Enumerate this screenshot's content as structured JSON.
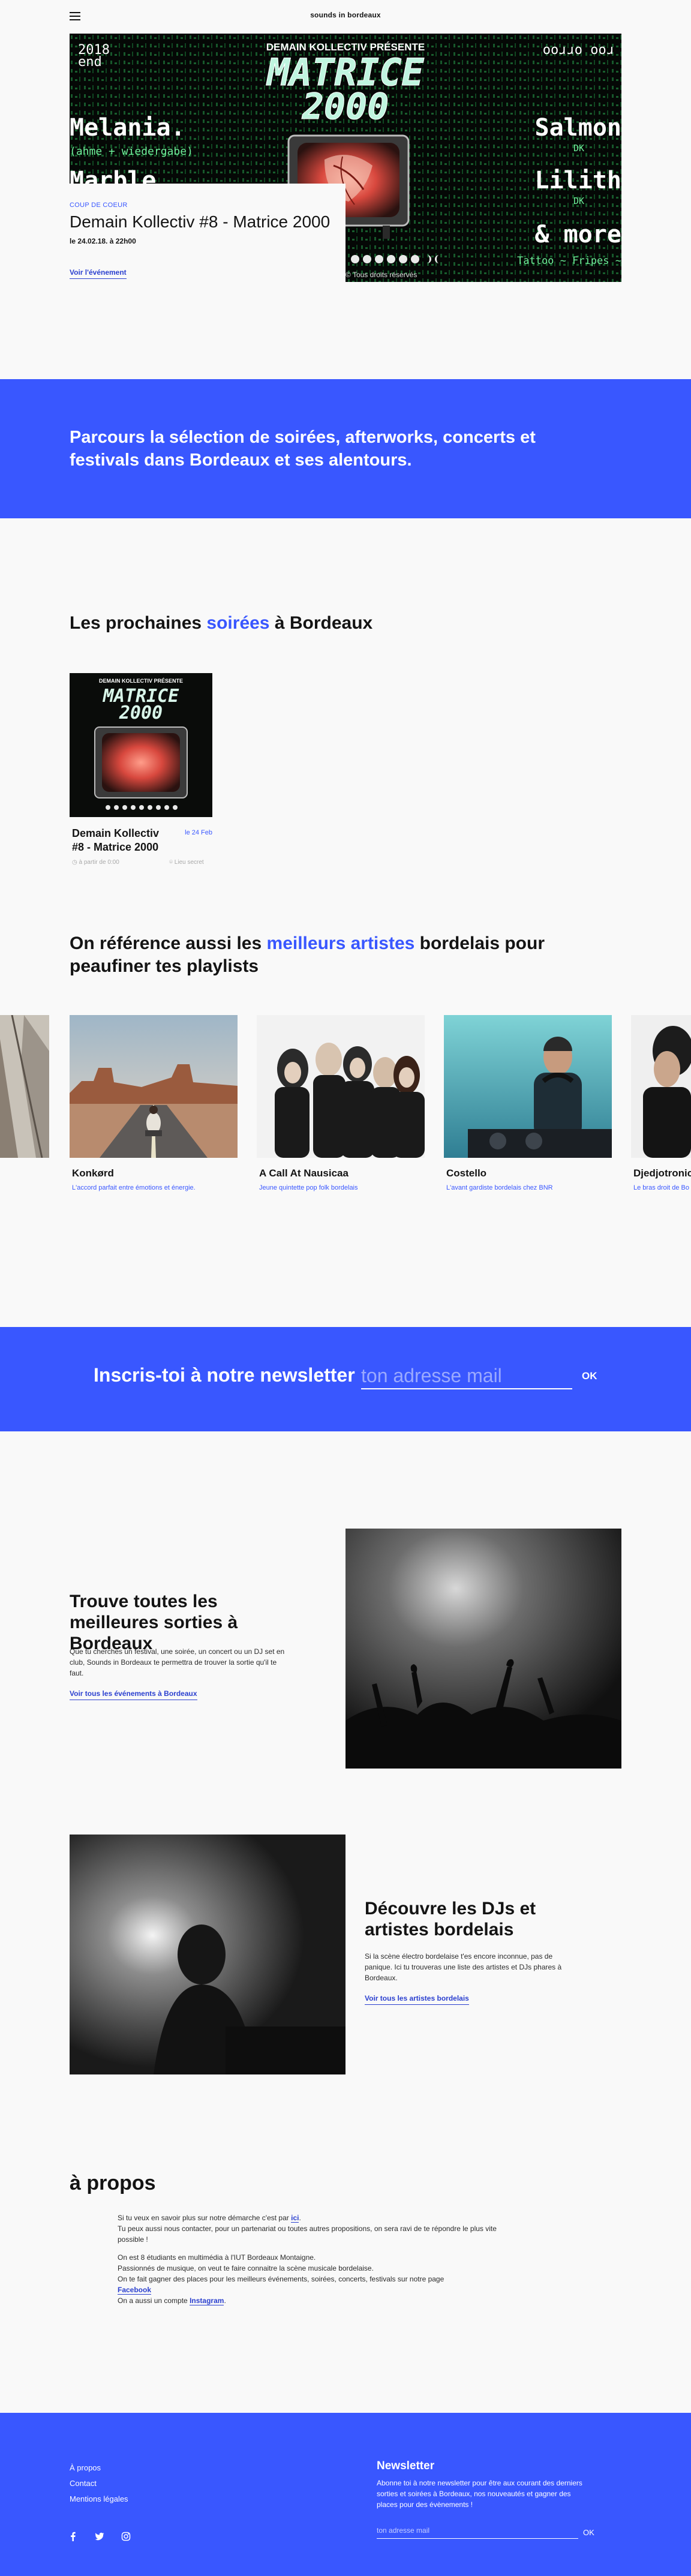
{
  "header": {
    "site_title": "sounds in bordeaux"
  },
  "hero": {
    "kicker": "COUP DE COEUR",
    "title": "Demain Kollectiv #8 - Matrice 2000",
    "date": "le 24.02.18. à 22h00",
    "link": "Voir l'événement",
    "poster": {
      "top_banner": "DEMAIN KOLLECTIV PRÉSENTE",
      "logo": "MATRICE",
      "logo_year": "2000",
      "corner_left": "2018",
      "corner_left_2": "end",
      "corner_right": "ooɹɹo ooɹ",
      "artists_left": [
        "Melania.",
        "Marble"
      ],
      "artists_left_sub": "(ahme + wiedergabe)",
      "artists_right": [
        "Salmon",
        "Lilith",
        "& more"
      ],
      "artists_right_sub": [
        "DK",
        "DK"
      ],
      "tagline": "Tattoo ~ Fripes ~ ",
      "credit": "© Tous droits réservés"
    }
  },
  "intro_band": {
    "text": "Parcours la sélection de soirées, afterworks, concerts et festivals dans Bordeaux et ses alentours."
  },
  "events_section": {
    "title_before": "Les prochaines ",
    "title_highlight": "soirées",
    "title_after": " à Bordeaux",
    "events": [
      {
        "title": "Demain Kollectiv #8 - Matrice 2000",
        "date": "le 24 Feb",
        "time": "à partir de 0:00",
        "place": "Lieu secret"
      }
    ]
  },
  "artists_section": {
    "title_before": "On référence aussi les ",
    "title_highlight": "meilleurs artistes",
    "title_after": " bordelais pour peaufiner tes playlists",
    "artists": [
      {
        "name": "Konkørd",
        "desc": "L'accord parfait entre émotions et énergie."
      },
      {
        "name": "A Call At Nausicaa",
        "desc": "Jeune quintette pop folk bordelais"
      },
      {
        "name": "Costello",
        "desc": "L'avant gardiste bordelais chez BNR"
      },
      {
        "name": "Djedjotronic",
        "desc": "Le bras droit de Bo"
      }
    ]
  },
  "newsletter_band": {
    "label": "Inscris-toi à notre newsletter",
    "placeholder": "ton adresse mail",
    "ok": "OK"
  },
  "feature_events": {
    "title": "Trouve toutes les meilleures sorties à Bordeaux",
    "text": "Que tu cherches un festival, une soirée, un concert ou un DJ set en club, Sounds in Bordeaux te permettra de trouver la sortie qu'il te faut.",
    "link": "Voir tous les événements à Bordeaux"
  },
  "feature_artists": {
    "title": "Découvre les DJs et artistes bordelais",
    "text": "Si la scène électro bordelaise t'es encore inconnue, pas de panique. Ici tu trouveras une liste des artistes et DJs phares à Bordeaux.",
    "link": "Voir tous les artistes bordelais"
  },
  "about": {
    "title": "à propos",
    "p1_before": "Si tu veux en savoir plus sur notre démarche c'est par ",
    "p1_link": "ici",
    "p1_after": ".",
    "p2": "Tu peux aussi nous contacter, pour un partenariat ou toutes autres propositions, on sera ravi de te répondre le plus vite possible !",
    "p3": "On est 8 étudiants en multimédia à l'IUT Bordeaux Montaigne.",
    "p4": "Passionnés de musique, on veut te faire connaitre la scène musicale bordelaise.",
    "p5": "On te fait gagner des places pour les meilleurs événements, soirées, concerts, festivals sur notre page",
    "p5_link": "Facebook",
    "p6_before": "On a aussi un compte ",
    "p6_link": "Instagram",
    "p6_after": "."
  },
  "footer": {
    "links": [
      "À propos",
      "Contact",
      "Mentions légales"
    ],
    "social_icons": [
      "facebook-icon",
      "twitter-icon",
      "instagram-icon"
    ],
    "newsletter_title": "Newsletter",
    "newsletter_text": "Abonne toi à notre newsletter pour être aux courant des derniers sorties et soirées à Bordeaux, nos nouveautés et gagner des places pour des évènements !",
    "placeholder": "ton adresse mail",
    "ok": "OK"
  },
  "colors": {
    "accent": "#3957ff",
    "background": "#f9f9f9",
    "text": "#141414"
  }
}
